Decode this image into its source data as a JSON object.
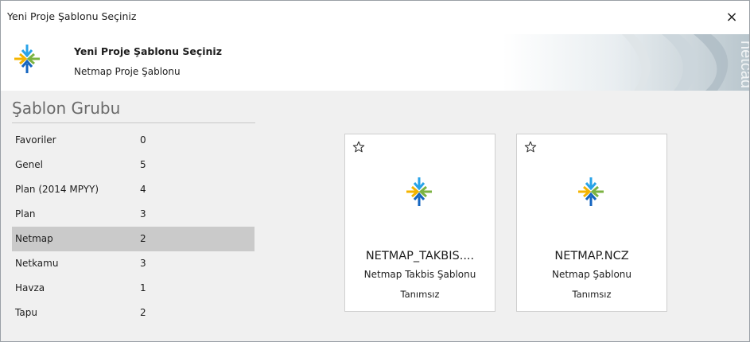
{
  "window": {
    "title": "Yeni Proje Şablonu Seçiniz",
    "close_glyph": "×"
  },
  "header": {
    "title": "Yeni Proje Şablonu Seçiniz",
    "subtitle": "Netmap Proje Şablonu",
    "brand_watermark": "netcad",
    "logo_icon": "netmap-logo-icon"
  },
  "sidebar": {
    "title": "Şablon Grubu",
    "items": [
      {
        "label": "Favoriler",
        "count": "0"
      },
      {
        "label": "Genel",
        "count": "5"
      },
      {
        "label": "Plan (2014 MPYY)",
        "count": "4"
      },
      {
        "label": "Plan",
        "count": "3"
      },
      {
        "label": "Netmap",
        "count": "2",
        "selected": true
      },
      {
        "label": "Netkamu",
        "count": "3"
      },
      {
        "label": "Havza",
        "count": "1"
      },
      {
        "label": "Tapu",
        "count": "2"
      }
    ]
  },
  "templates": [
    {
      "name": "NETMAP_TAKBIS....",
      "description": "Netmap Takbis Şablonu",
      "status": "Tanımsız",
      "icon": "star-outline-icon"
    },
    {
      "name": "NETMAP.NCZ",
      "description": "Netmap Şablonu",
      "status": "Tanımsız",
      "icon": "star-outline-icon"
    }
  ],
  "colors": {
    "selected_row": "#cacaca",
    "logo_blue": "#1e88e5",
    "logo_yellow": "#f4b400",
    "logo_green": "#7cb342"
  }
}
